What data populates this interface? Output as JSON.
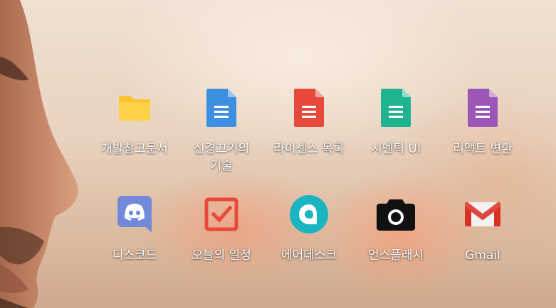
{
  "apps": [
    {
      "id": "dev-docs",
      "label": "개발참고문서",
      "icon": "folder-icon",
      "color": "#f8c32b"
    },
    {
      "id": "sinkyeong",
      "label": "신경끄기의 기술",
      "icon": "doc-icon",
      "color": "#3d8fe0"
    },
    {
      "id": "license",
      "label": "라이센스 목록",
      "icon": "doc-icon",
      "color": "#e8493b"
    },
    {
      "id": "semantic-ui",
      "label": "시멘틱 UI",
      "icon": "doc-icon",
      "color": "#1fb48f"
    },
    {
      "id": "react",
      "label": "리액트 변환",
      "icon": "doc-icon",
      "color": "#9c56b8"
    },
    {
      "id": "discord",
      "label": "디스코드",
      "icon": "discord-icon",
      "color": "#7289da"
    },
    {
      "id": "today",
      "label": "오늘의 일정",
      "icon": "checkbox-icon",
      "color": "#e8493b"
    },
    {
      "id": "airdesk",
      "label": "에어데스크",
      "icon": "airdesk-icon",
      "color": "#1bb5c1"
    },
    {
      "id": "unsplash",
      "label": "언스플래시",
      "icon": "camera-icon",
      "color": "#111111"
    },
    {
      "id": "gmail",
      "label": "Gmail",
      "icon": "gmail-icon",
      "color": "#d93025"
    }
  ]
}
